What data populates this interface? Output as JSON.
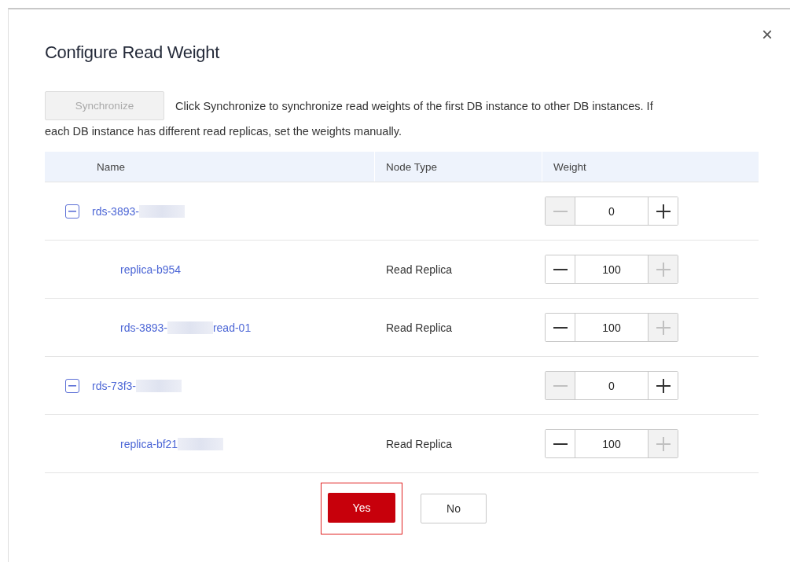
{
  "dialog": {
    "title": "Configure Read Weight",
    "close": "×"
  },
  "sync": {
    "button": {
      "label": "Synchronize",
      "disabled": true
    },
    "note_lines": [
      "Click Synchronize to synchronize read weights of the first DB instance to other DB instances. If",
      "each DB instance has different read replicas, set the weights manually."
    ]
  },
  "table": {
    "columns": [
      "Name",
      "Node Type",
      "Weight"
    ],
    "rows": [
      {
        "kind": "instance",
        "expanded": true,
        "name": "rds-3893-",
        "redacted": true,
        "suffix": "",
        "node_type": "",
        "weight": "0",
        "minus_disabled": true,
        "plus_disabled": false
      },
      {
        "kind": "replica",
        "name": "replica-b954",
        "suffix": "",
        "node_type": "Read Replica",
        "weight": "100",
        "minus_disabled": false,
        "plus_disabled": true
      },
      {
        "kind": "replica",
        "name": "rds-3893-",
        "redacted": true,
        "suffix": "read-01",
        "node_type": "Read Replica",
        "weight": "100",
        "minus_disabled": false,
        "plus_disabled": true
      },
      {
        "kind": "instance",
        "expanded": true,
        "name": "rds-73f3-",
        "redacted": true,
        "suffix": "",
        "node_type": "",
        "weight": "0",
        "minus_disabled": true,
        "plus_disabled": false
      },
      {
        "kind": "replica",
        "name": "replica-bf21",
        "redacted": true,
        "suffix": "",
        "node_type": "Read Replica",
        "weight": "100",
        "minus_disabled": false,
        "plus_disabled": true
      }
    ]
  },
  "footer": {
    "yes": {
      "label": "Yes",
      "highlighted": true
    },
    "no": {
      "label": "No"
    }
  }
}
